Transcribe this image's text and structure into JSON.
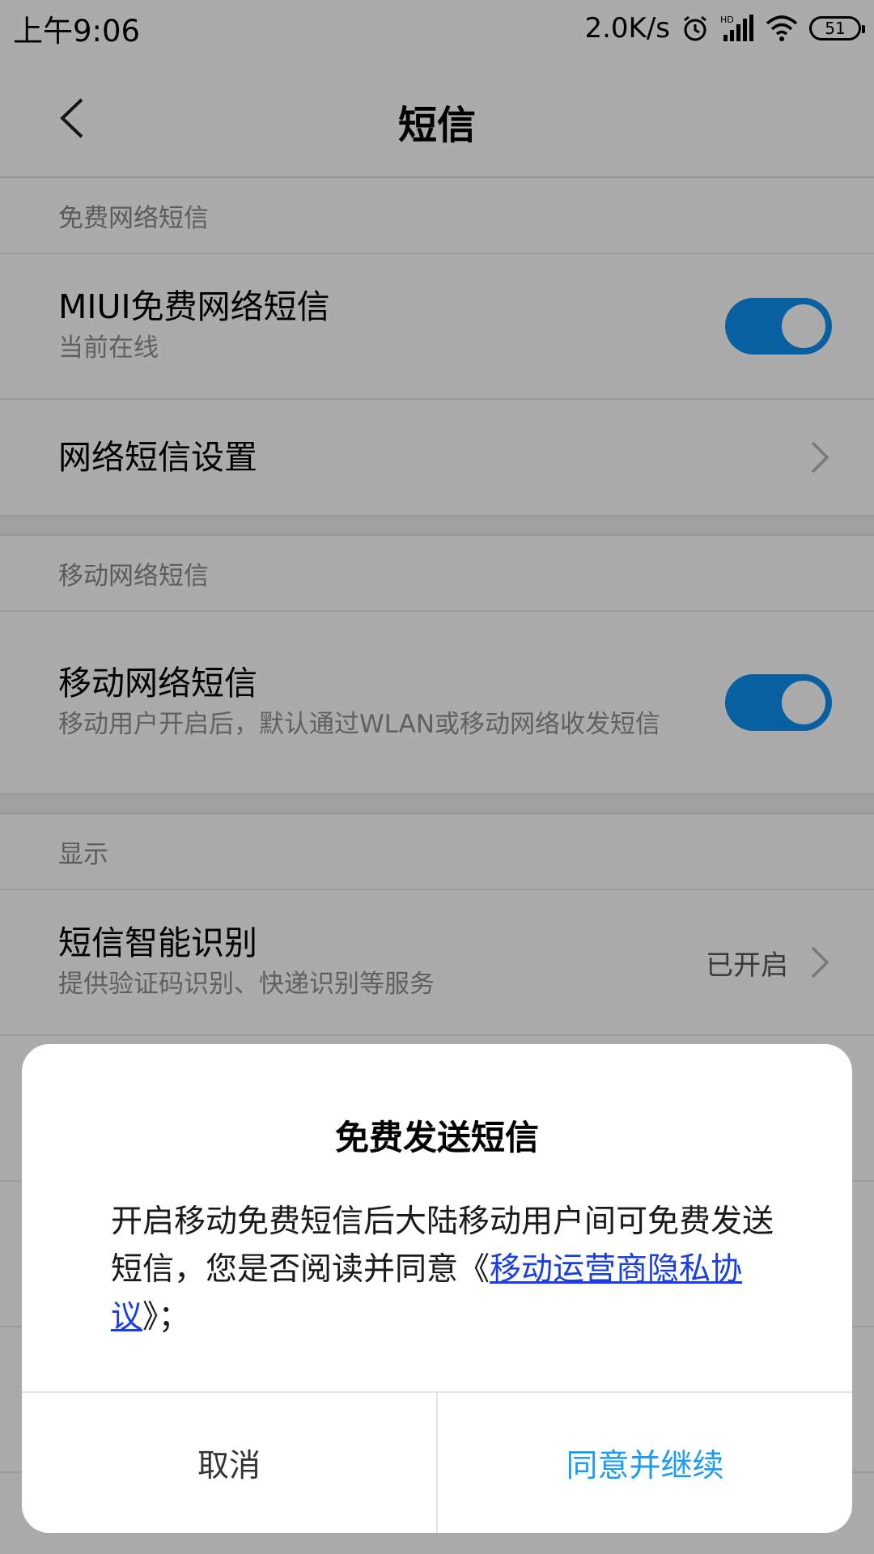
{
  "status_bar": {
    "time": "上午9:06",
    "net_speed": "2.0K/s",
    "battery": "51",
    "icons": [
      "alarm-icon",
      "hd-signal-icon",
      "wifi-icon",
      "battery-icon"
    ]
  },
  "navbar": {
    "title": "短信",
    "back_icon": "chevron-left-icon"
  },
  "sections": {
    "free": {
      "header": "免费网络短信",
      "miui_title": "MIUI免费网络短信",
      "miui_sub": "当前在线",
      "miui_toggle_on": true,
      "net_settings_title": "网络短信设置"
    },
    "mobile": {
      "header": "移动网络短信",
      "title": "移动网络短信",
      "sub": "移动用户开启后，默认通过WLAN或移动网络收发短信",
      "toggle_on": true
    },
    "display": {
      "header": "显示",
      "smart_title": "短信智能识别",
      "smart_sub": "提供验证码识别、快递识别等服务",
      "smart_value": "已开启"
    }
  },
  "dialog": {
    "title": "免费发送短信",
    "message_before": "开启移动免费短信后大陆移动用户间可免费发送短信，您是否阅读并同意《",
    "message_link": "移动运营商隐私协议",
    "message_after": "》；",
    "cancel_label": "取消",
    "confirm_label": "同意并继续"
  },
  "colors": {
    "accent": "#0c8ff0",
    "link": "#1a3fe0",
    "confirm": "#1a9cf3"
  }
}
